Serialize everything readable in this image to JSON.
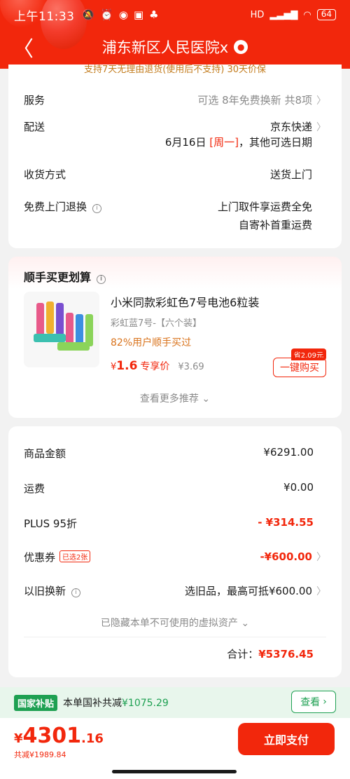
{
  "status_bar": {
    "time": "上午11:33",
    "hd": "HD",
    "battery": "64"
  },
  "nav": {
    "back": "〈",
    "title": "浦东新区人民医院x"
  },
  "delivery_card": {
    "banner": "支持7天无理由退货(使用后不支持)  30天价保",
    "service_label": "服务",
    "service_value": "可选 8年免费换新 共8项",
    "shipping_label": "配送",
    "shipping_carrier": "京东快递",
    "shipping_date": "6月16日",
    "shipping_weekday": "[周一]",
    "shipping_other": "，其他可选日期",
    "receive_label": "收货方式",
    "receive_value": "送货上门",
    "return_label": "免费上门退换",
    "return_value_line1": "上门取件享运费全免",
    "return_value_line2": "自寄补首重运费"
  },
  "addon_card": {
    "title": "顺手买更划算",
    "product_name": "小米同款彩虹色7号电池6粒装",
    "product_spec": "彩虹蓝7号-【六个装】",
    "buy_rate": "82%用户顺手买过",
    "price_currency": "¥",
    "price_value": "1.6",
    "price_tag": "专享价",
    "original_price": "¥3.69",
    "save_badge": "省2.09元",
    "buy_button": "一键购买",
    "more_recommend": "查看更多推荐"
  },
  "summary_card": {
    "goods_label": "商品金额",
    "goods_value": "¥6291.00",
    "freight_label": "运费",
    "freight_value": "¥0.00",
    "plus_label": "PLUS 95折",
    "plus_value": "- ¥314.55",
    "coupon_label": "优惠券",
    "coupon_tag": "已选2张",
    "coupon_value": "-¥600.00",
    "tradein_label": "以旧换新",
    "tradein_value": "选旧品，最高可抵¥600.00",
    "hidden_assets": "已隐藏本单不可使用的虚拟资产",
    "total_label": "合计：",
    "total_value": "¥5376.45"
  },
  "subsidy": {
    "badge": "国家补贴",
    "text": "本单国补共减",
    "amount": "¥1075.29",
    "view_button": "查看"
  },
  "footer": {
    "currency": "¥",
    "price_int": "4301",
    "price_dec": ".16",
    "saved": "共减¥1989.84",
    "pay_button": "立即支付"
  },
  "colors": {
    "brand_red": "#f2270c",
    "subsidy_green": "#1ea052"
  }
}
